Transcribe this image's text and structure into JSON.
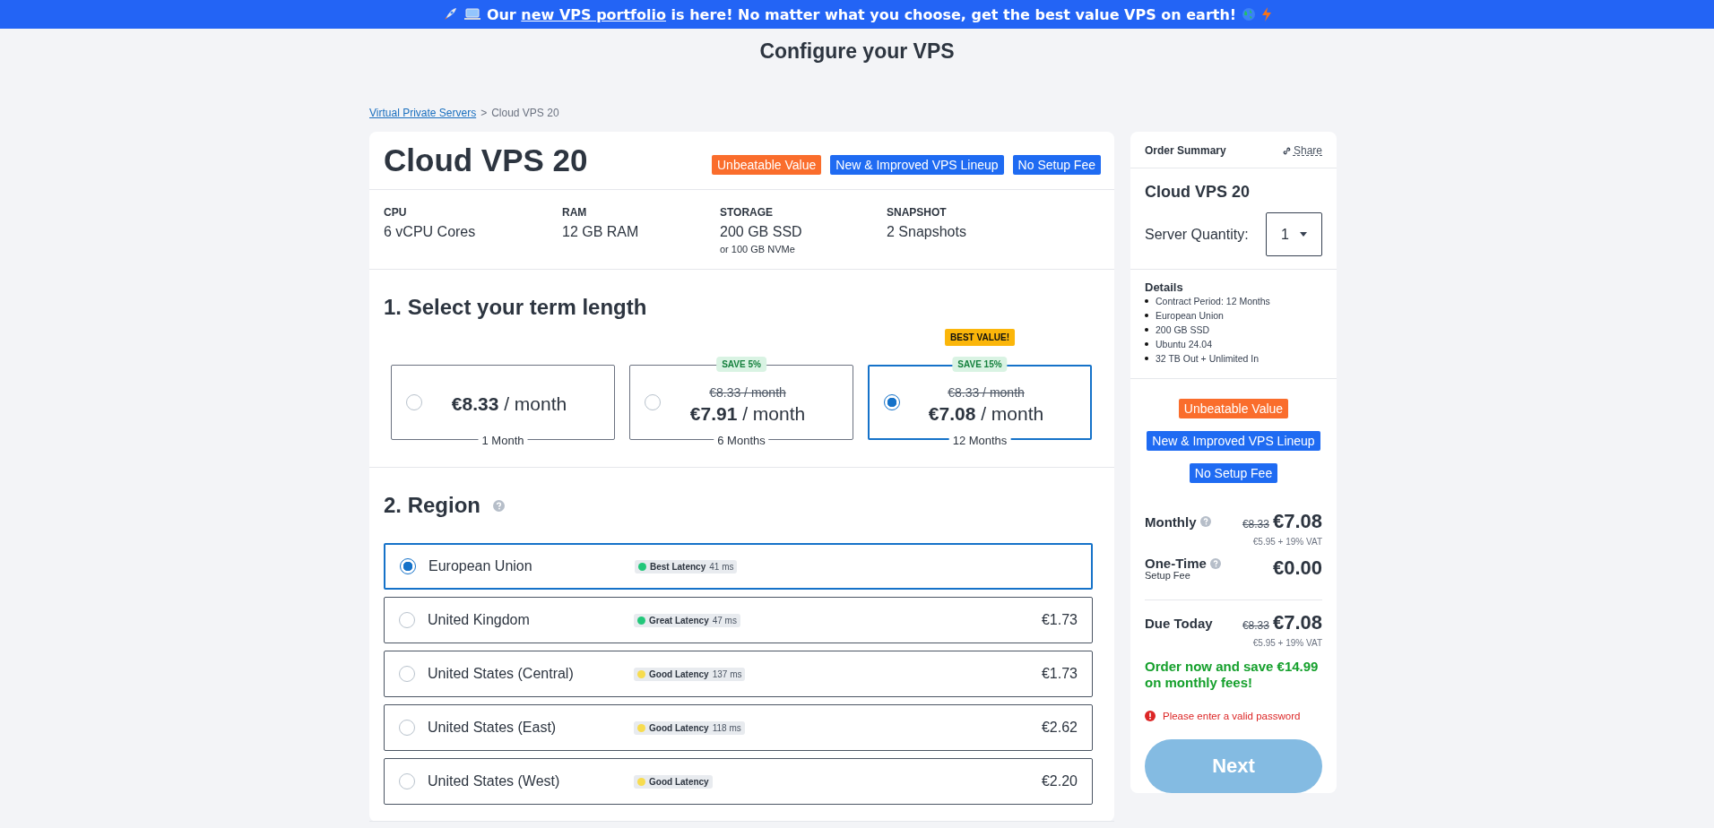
{
  "banner": {
    "prefix": "Our",
    "link": "new VPS portfolio",
    "suffix": "is here! No matter what you choose, get the best value VPS on earth!"
  },
  "page_title": "Configure your VPS",
  "breadcrumb": {
    "parent": "Virtual Private Servers",
    "separator": ">",
    "current": "Cloud VPS 20"
  },
  "product": {
    "name": "Cloud VPS 20",
    "badges": [
      {
        "label": "Unbeatable Value",
        "color": "#fa6d2c"
      },
      {
        "label": "New & Improved VPS Lineup",
        "color": "#1f6bf2"
      },
      {
        "label": "No Setup Fee",
        "color": "#1f6bf2"
      }
    ],
    "specs": [
      {
        "label": "CPU",
        "value": "6 vCPU Cores"
      },
      {
        "label": "RAM",
        "value": "12 GB RAM"
      },
      {
        "label": "STORAGE",
        "value": "200 GB SSD",
        "note": "or 100 GB NVMe"
      },
      {
        "label": "SNAPSHOT",
        "value": "2 Snapshots"
      }
    ]
  },
  "term": {
    "heading": "1. Select your term length",
    "options": [
      {
        "price": "€8.33",
        "unit": "/ month",
        "term": "1 Month",
        "selected": false
      },
      {
        "price": "€7.91",
        "unit": "/ month",
        "old_price": "€8.33 / month",
        "save": "SAVE 5%",
        "term": "6 Months",
        "selected": false
      },
      {
        "price": "€7.08",
        "unit": "/ month",
        "old_price": "€8.33 / month",
        "save": "SAVE 15%",
        "flag": "BEST VALUE!",
        "term": "12 Months",
        "selected": true
      }
    ]
  },
  "region": {
    "heading": "2. Region",
    "options": [
      {
        "name": "European Union",
        "latency": "Best Latency",
        "ms": "41 ms",
        "color": "#22c77a",
        "selected": true
      },
      {
        "name": "United Kingdom",
        "latency": "Great Latency",
        "ms": "47 ms",
        "color": "#22c77a",
        "price": "€1.73",
        "selected": false
      },
      {
        "name": "United States (Central)",
        "latency": "Good Latency",
        "ms": "137 ms",
        "color": "#f7dc4f",
        "price": "€1.73",
        "selected": false
      },
      {
        "name": "United States (East)",
        "latency": "Good Latency",
        "ms": "118 ms",
        "color": "#f7dc4f",
        "price": "€2.62",
        "selected": false
      },
      {
        "name": "United States (West)",
        "latency": "Good Latency",
        "color": "#f7dc4f",
        "price": "€2.20",
        "selected": false
      }
    ]
  },
  "summary": {
    "title": "Order Summary",
    "share": "Share",
    "product": "Cloud VPS 20",
    "quantity_label": "Server Quantity:",
    "quantity": "1",
    "details_title": "Details",
    "details": [
      "Contract Period: 12 Months",
      "European Union",
      "200 GB SSD",
      "Ubuntu 24.04",
      "32 TB Out + Unlimited In"
    ],
    "badges": [
      {
        "label": "Unbeatable Value",
        "color": "#fa6d2c"
      },
      {
        "label": "New & Improved VPS Lineup",
        "color": "#1f6bf2"
      },
      {
        "label": "No Setup Fee",
        "color": "#1f6bf2"
      }
    ],
    "monthly": {
      "label": "Monthly",
      "old": "€8.33",
      "price": "€7.08",
      "vat": "€5.95 + 19% VAT"
    },
    "setup": {
      "label": "One-Time",
      "sub": "Setup Fee",
      "price": "€0.00"
    },
    "due": {
      "label": "Due Today",
      "old": "€8.33",
      "price": "€7.08",
      "vat": "€5.95 + 19% VAT"
    },
    "savings": "Order now and save €14.99 on monthly fees!",
    "error": "Please enter a valid password",
    "next": "Next"
  }
}
